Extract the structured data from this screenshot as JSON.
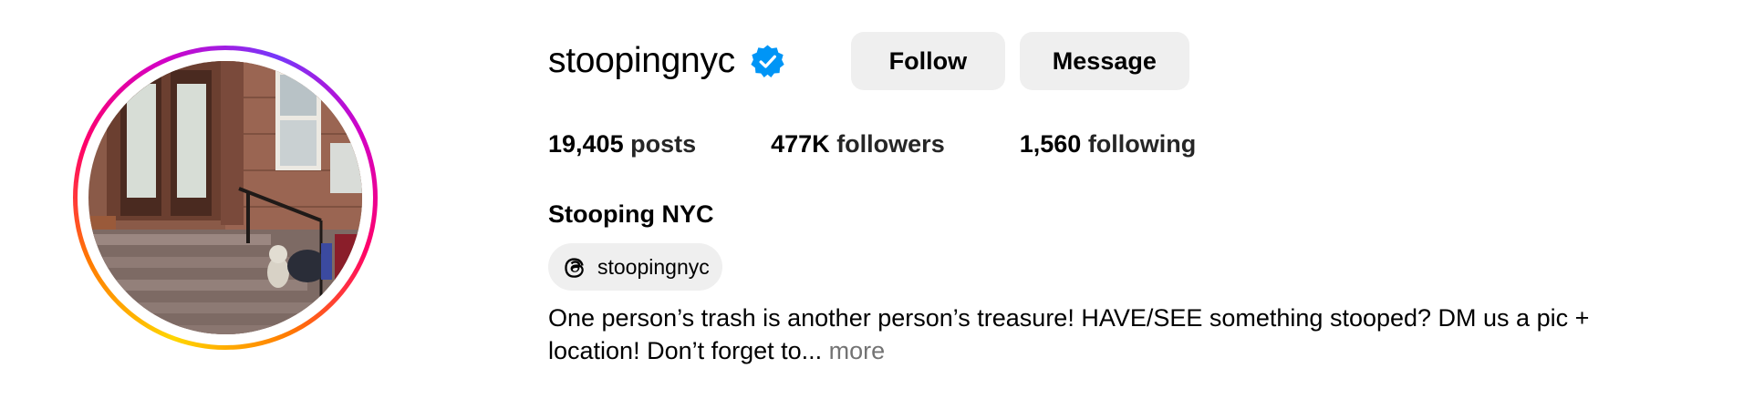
{
  "profile": {
    "username": "stoopingnyc",
    "verified": true,
    "full_name": "Stooping NYC",
    "buttons": {
      "follow": "Follow",
      "message": "Message"
    },
    "stats": {
      "posts_count": "19,405",
      "posts_label": "posts",
      "followers_count": "477K",
      "followers_label": "followers",
      "following_count": "1,560",
      "following_label": "following"
    },
    "threads": {
      "handle": "stoopingnyc",
      "icon": "threads-icon"
    },
    "bio": {
      "text": "One person’s trash is another person’s treasure! HAVE/SEE something stooped? DM us a pic + location! Don’t forget to... ",
      "more_label": "more"
    }
  },
  "colors": {
    "verified_badge": "#0095f6",
    "button_bg": "#efefef",
    "muted_text": "#737373",
    "story_ring_start": "#ffd600",
    "story_ring_end": "#d300c5"
  }
}
